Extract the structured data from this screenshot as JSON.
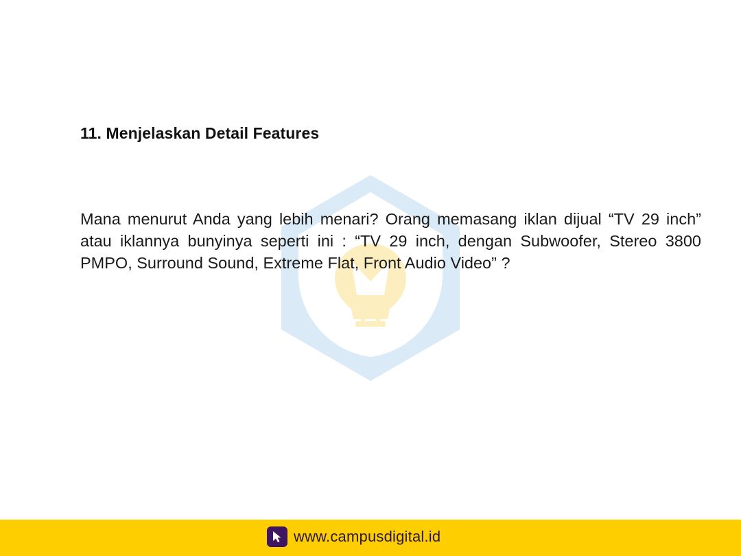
{
  "slide": {
    "title": "11. Menjelaskan Detail Features",
    "body": "Mana menurut Anda yang lebih menari? Orang memasang iklan dijual “TV 29 inch” atau iklannya bunyinya seperti ini : “TV 29 inch, dengan Subwoofer, Stereo 3800 PMPO, Surround Sound, Extreme Flat, Front Audio Video” ?"
  },
  "footer": {
    "url": "www.campusdigital.id",
    "icon": "cursor-arrow-icon",
    "background_color": "#FFCE00",
    "icon_box_color": "#3D1560"
  },
  "watermark": {
    "icon": "hexagon-lightbulb-logo",
    "hex_color": "#7DB6E6",
    "bulb_color": "#F5C518"
  }
}
